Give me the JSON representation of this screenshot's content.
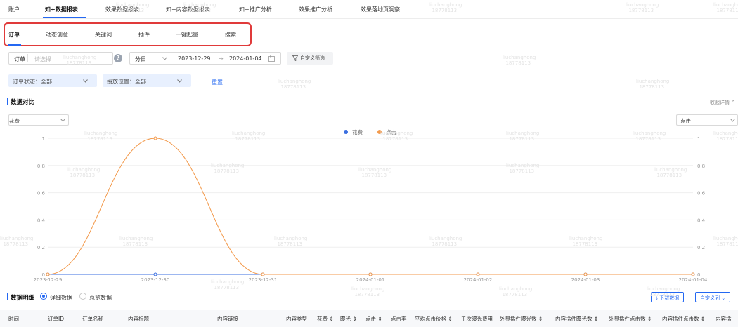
{
  "top_nav": {
    "items": [
      "账户",
      "知+数据报表",
      "效果数据报表",
      "知+内容数据报表",
      "知+推广分析",
      "效果推广分析",
      "效果落地页洞察"
    ],
    "active_index": 1
  },
  "sub_tabs": {
    "items": [
      "订单",
      "动态创意",
      "关键词",
      "插件",
      "一键起量",
      "搜索"
    ],
    "active_index": 0
  },
  "filters": {
    "order_label": "订单",
    "order_placeholder": "请选择",
    "help_icon": "question-circle-icon",
    "granularity": "分日",
    "date_start": "2023-12-29",
    "date_sep": "→",
    "date_end": "2024-01-04",
    "custom_filter": "自定义筛选",
    "order_status": "订单状态：全部",
    "placement": "投放位置：全部",
    "reset": "重置"
  },
  "data_compare": {
    "title": "数据对比",
    "collapse": "收起详情",
    "left_metric": "花费",
    "right_metric": "点击"
  },
  "colors": {
    "accent": "#2468f2",
    "spend": "#3b6fe0",
    "clicks": "#f39a4c",
    "highlight_box": "#e03a3a"
  },
  "chart_data": {
    "type": "line",
    "x": [
      "2023-12-29",
      "2023-12-30",
      "2023-12-31",
      "2024-01-01",
      "2024-01-02",
      "2024-01-03",
      "2024-01-04"
    ],
    "series": [
      {
        "name": "花费",
        "values": [
          0,
          0,
          0,
          0,
          0,
          0,
          0
        ]
      },
      {
        "name": "点击",
        "values": [
          0,
          1,
          0,
          0,
          0,
          0,
          0
        ]
      }
    ],
    "y_ticks": [
      "0",
      "0.2",
      "0.4",
      "0.6",
      "0.8",
      "1"
    ],
    "ylim": [
      0,
      1
    ],
    "legend_position": "top-center",
    "grid": true
  },
  "detail": {
    "title": "数据明细",
    "radio_detail": "详细数据",
    "radio_summary": "总览数据",
    "download": "下载数据",
    "custom_columns": "自定义列",
    "columns": [
      "时间",
      "订单ID",
      "订单名称",
      "内容标题",
      "内容链接",
      "内容类型",
      "花费",
      "曝光",
      "点击",
      "点击率",
      "平均点击价格",
      "千次曝光费用",
      "外显插件曝光数",
      "内容插件曝光数",
      "外显插件点击数",
      "内容插件点击数",
      "内容插"
    ]
  },
  "watermark": {
    "name": "liuchanghong",
    "id": "18778113"
  }
}
